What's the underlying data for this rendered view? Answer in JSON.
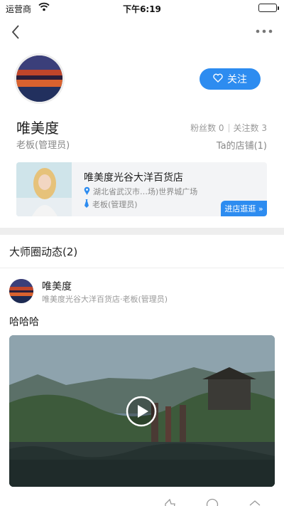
{
  "status_bar": {
    "carrier": "运营商",
    "time": "下午6:19"
  },
  "profile": {
    "follow_label": "关注",
    "name": "唯美度",
    "role": "老板(管理员)",
    "fans": "粉丝数 0",
    "following": "关注数 3",
    "stores": "Ta的店铺(1)"
  },
  "store": {
    "title": "唯美度光谷大洋百货店",
    "address": "湖北省武汉市…场)世界城广场",
    "owner": "老板(管理员)",
    "visit_label": "进店逛逛 »"
  },
  "feed": {
    "section_title": "大师圈动态(2)",
    "post": {
      "author": "唯美度",
      "subtitle": "唯美度光谷大洋百货店·老板(管理员)",
      "text": "哈哈哈"
    }
  },
  "colors": {
    "accent": "#2d8cf0"
  }
}
